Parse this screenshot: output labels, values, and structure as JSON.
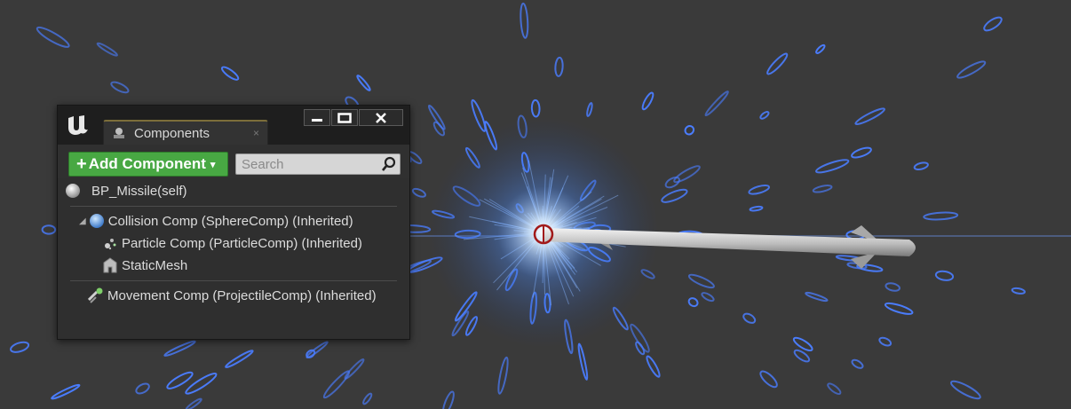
{
  "window": {
    "tab_label": "Components",
    "tab_close": "×"
  },
  "toolbar": {
    "add_plus": "+",
    "add_label": "Add Component",
    "add_caret": "▾",
    "search_placeholder": "Search"
  },
  "tree": {
    "root": "BP_Missile(self)",
    "expand_arrow": "◢",
    "items": [
      {
        "label": "Collision Comp (SphereComp) (Inherited)"
      },
      {
        "label": "Particle Comp (ParticleComp) (Inherited)"
      },
      {
        "label": "StaticMesh"
      },
      {
        "label": "Movement Comp (ProjectileComp) (Inherited)"
      }
    ]
  },
  "colors": {
    "add_button": "#48a843",
    "particles": "#4a7dff",
    "window_bg": "#2f2f2f"
  },
  "icons": [
    "ue-logo-icon",
    "component-tab-icon",
    "minimize-icon",
    "maximize-icon",
    "close-icon",
    "search-icon",
    "actor-sphere-icon",
    "sphere-component-icon",
    "particle-icon",
    "static-mesh-icon",
    "movement-icon"
  ]
}
